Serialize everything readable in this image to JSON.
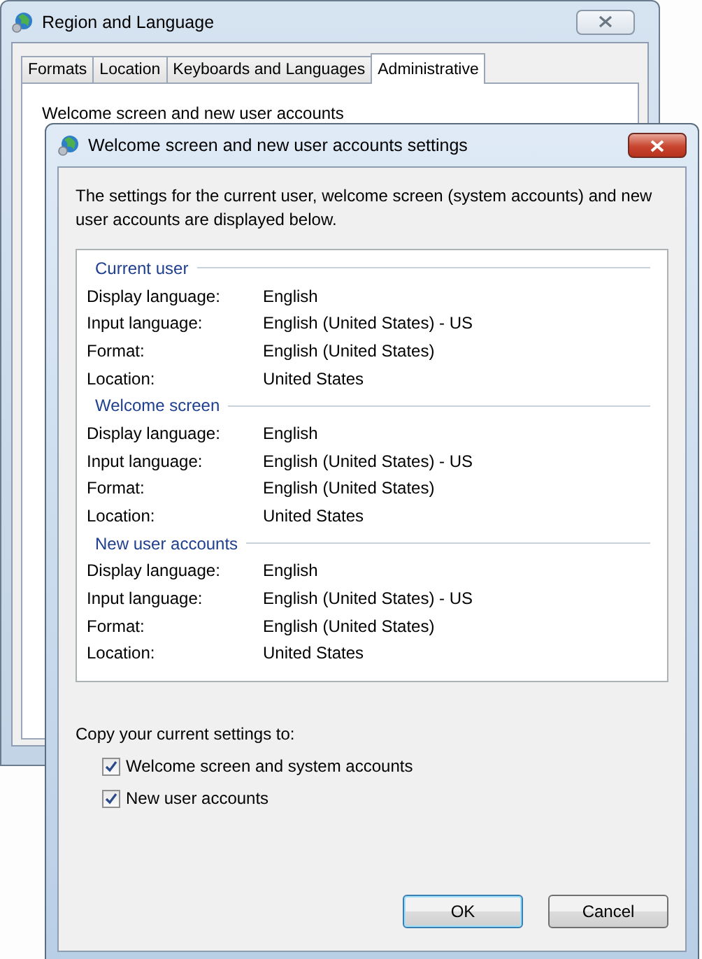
{
  "background_window": {
    "title": "Region and Language",
    "tabs": [
      {
        "label": "Formats",
        "selected": false
      },
      {
        "label": "Location",
        "selected": false
      },
      {
        "label": "Keyboards and Languages",
        "selected": false
      },
      {
        "label": "Administrative",
        "selected": true
      }
    ],
    "group_title": "Welcome screen and new user accounts"
  },
  "dialog": {
    "title": "Welcome screen and new user accounts settings",
    "intro": "The settings for the current user, welcome screen (system accounts) and new user accounts are displayed below.",
    "sections": [
      {
        "title": "Current user",
        "rows": [
          {
            "label": "Display language:",
            "value": "English"
          },
          {
            "label": "Input language:",
            "value": "English (United States) - US"
          },
          {
            "label": "Format:",
            "value": "English (United States)"
          },
          {
            "label": "Location:",
            "value": "United States"
          }
        ]
      },
      {
        "title": "Welcome screen",
        "rows": [
          {
            "label": "Display language:",
            "value": "English"
          },
          {
            "label": "Input language:",
            "value": "English (United States) - US"
          },
          {
            "label": "Format:",
            "value": "English (United States)"
          },
          {
            "label": "Location:",
            "value": "United States"
          }
        ]
      },
      {
        "title": "New user accounts",
        "rows": [
          {
            "label": "Display language:",
            "value": "English"
          },
          {
            "label": "Input language:",
            "value": "English (United States) - US"
          },
          {
            "label": "Format:",
            "value": "English (United States)"
          },
          {
            "label": "Location:",
            "value": "United States"
          }
        ]
      }
    ],
    "copy_label": "Copy your current settings to:",
    "checkboxes": [
      {
        "label": "Welcome screen and system accounts",
        "checked": true
      },
      {
        "label": "New user accounts",
        "checked": true
      }
    ],
    "buttons": [
      {
        "label": "OK",
        "default": true
      },
      {
        "label": "Cancel",
        "default": false
      }
    ]
  }
}
